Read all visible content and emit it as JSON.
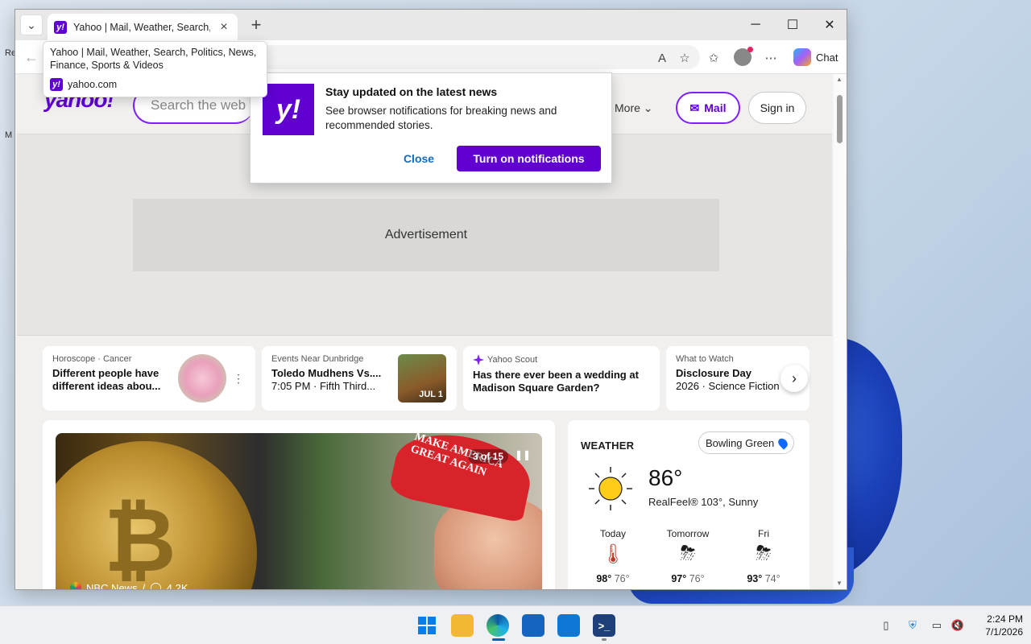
{
  "browser": {
    "tab_title": "Yahoo | Mail, Weather, Search, Politics, News, Finance, Sports & Videos",
    "chat_label": "Chat"
  },
  "tooltip": {
    "title": "Yahoo | Mail, Weather, Search, Politics, News, Finance, Sports & Videos",
    "url": "yahoo.com"
  },
  "header": {
    "logo": "yahoo!",
    "search_placeholder": "Search the web",
    "more_label": "More",
    "mail_label": "Mail",
    "signin_label": "Sign in"
  },
  "ad": {
    "label": "Advertisement"
  },
  "notification": {
    "logo": "y!",
    "title": "Stay updated on the latest news",
    "body": "See browser notifications for breaking news and recommended stories.",
    "close_label": "Close",
    "turn_on_label": "Turn on notifications"
  },
  "cards": [
    {
      "kicker": "Horoscope · Cancer",
      "head": "Different people have different ideas abou...",
      "sub": ""
    },
    {
      "kicker": "Events Near Dunbridge",
      "head": "Toledo Mudhens Vs....",
      "sub": "7:05 PM · Fifth Third...",
      "badge": "JUL 1"
    },
    {
      "kicker": "Yahoo Scout",
      "head": "Has there ever been a wedding at Madison Square Garden?",
      "sub": ""
    },
    {
      "kicker": "What to Watch",
      "head": "Disclosure Day",
      "sub": "2026 · Science Fiction"
    }
  ],
  "hero": {
    "slide_count": "3 of 15",
    "source": "NBC News",
    "separator": "/",
    "comments": "4.2K",
    "cap_text": "MAKE AMERICA GREAT AGAIN"
  },
  "weather": {
    "title": "WEATHER",
    "location": "Bowling Green",
    "temp": "86°",
    "realfeel": "RealFeel® 103°, Sunny",
    "days": [
      {
        "label": "Today",
        "high": "98°",
        "low": "76°",
        "icon": "thermometer-icon"
      },
      {
        "label": "Tomorrow",
        "high": "97°",
        "low": "76°",
        "icon": "thunderstorm-icon"
      },
      {
        "label": "Fri",
        "high": "93°",
        "low": "74°",
        "icon": "thunderstorm-icon"
      }
    ]
  },
  "taskbar": {
    "time": "2:24 PM",
    "date": "7/1/2026"
  },
  "desktop": {
    "frag1": "Re",
    "frag2": "M"
  }
}
